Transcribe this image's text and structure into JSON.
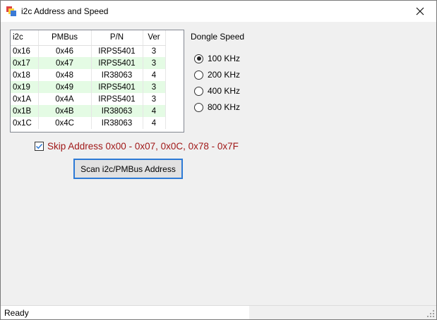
{
  "window": {
    "title": "i2c Address and Speed",
    "close_glyph": "✕"
  },
  "grid": {
    "headers": [
      "i2c",
      "PMBus",
      "P/N",
      "Ver"
    ],
    "rows": [
      [
        "0x16",
        "0x46",
        "IRPS5401",
        "3"
      ],
      [
        "0x17",
        "0x47",
        "IRPS5401",
        "3"
      ],
      [
        "0x18",
        "0x48",
        "IR38063",
        "4"
      ],
      [
        "0x19",
        "0x49",
        "IRPS5401",
        "3"
      ],
      [
        "0x1A",
        "0x4A",
        "IRPS5401",
        "3"
      ],
      [
        "0x1B",
        "0x4B",
        "IR38063",
        "4"
      ],
      [
        "0x1C",
        "0x4C",
        "IR38063",
        "4"
      ]
    ],
    "alt_row_color": "#e4fbe4"
  },
  "dongle_speed": {
    "title": "Dongle Speed",
    "options": [
      "100 KHz",
      "200 KHz",
      "400 KHz",
      "800 KHz"
    ],
    "selected": "100 KHz"
  },
  "skip": {
    "label": "Skip Address 0x00 - 0x07, 0x0C, 0x78 - 0x7F",
    "checked": true,
    "color": "#a01818"
  },
  "scan_button": {
    "label": "Scan i2c/PMBus Address",
    "focus_color": "#2d7ad6"
  },
  "status": {
    "text": "Ready"
  }
}
